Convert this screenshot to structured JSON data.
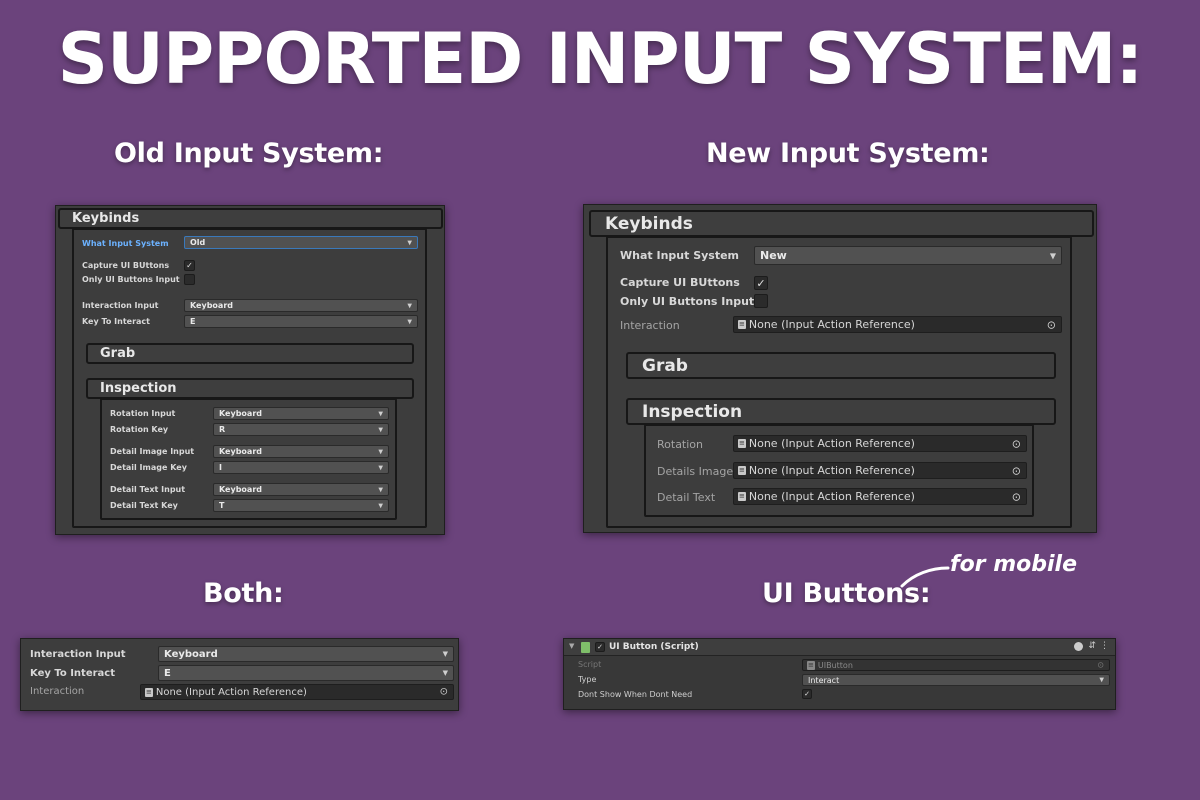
{
  "title": "SUPPORTED INPUT SYSTEM:",
  "old": {
    "heading": "Old Input System:",
    "keybinds": "Keybinds",
    "what_input_label": "What Input System",
    "what_input_value": "Old",
    "capture_label": "Capture UI BUttons",
    "capture_checked": true,
    "only_ui_label": "Only UI Buttons Input",
    "only_ui_checked": false,
    "interaction_input_label": "Interaction Input",
    "interaction_input_value": "Keyboard",
    "key_interact_label": "Key To Interact",
    "key_interact_value": "E",
    "grab": "Grab",
    "inspection": "Inspection",
    "rotation_input_label": "Rotation Input",
    "rotation_input_value": "Keyboard",
    "rotation_key_label": "Rotation Key",
    "rotation_key_value": "R",
    "detail_image_input_label": "Detail Image Input",
    "detail_image_input_value": "Keyboard",
    "detail_image_key_label": "Detail Image Key",
    "detail_image_key_value": "I",
    "detail_text_input_label": "Detail Text Input",
    "detail_text_input_value": "Keyboard",
    "detail_text_key_label": "Detail Text Key",
    "detail_text_key_value": "T"
  },
  "new": {
    "heading": "New Input System:",
    "keybinds": "Keybinds",
    "what_input_label": "What Input System",
    "what_input_value": "New",
    "capture_label": "Capture UI BUttons",
    "capture_checked": true,
    "only_ui_label": "Only UI Buttons Input",
    "only_ui_checked": false,
    "interaction_label": "Interaction",
    "interaction_value": "None (Input Action Reference)",
    "grab": "Grab",
    "inspection": "Inspection",
    "rotation_label": "Rotation",
    "rotation_value": "None (Input Action Reference)",
    "details_image_label": "Details Image",
    "details_image_value": "None (Input Action Reference)",
    "detail_text_label": "Detail Text",
    "detail_text_value": "None (Input Action Reference)"
  },
  "both": {
    "heading": "Both:",
    "interaction_input_label": "Interaction Input",
    "interaction_input_value": "Keyboard",
    "key_interact_label": "Key To Interact",
    "key_interact_value": "E",
    "interaction_label": "Interaction",
    "interaction_value": "None (Input Action Reference)"
  },
  "ui_buttons": {
    "heading": "UI Buttons:",
    "note": "for mobile",
    "component_title": "UI Button (Script)",
    "script_label": "Script",
    "script_value": "UIButton",
    "type_label": "Type",
    "type_value": "Interact",
    "dont_show_label": "Dont Show When Dont Need",
    "dont_show_checked": true
  },
  "icons": {
    "dropdown_arrow": "▼",
    "check": "✓",
    "target": "⊙",
    "doc": "≡"
  },
  "colors": {
    "background": "#6b437c",
    "panel": "#3d3d3d",
    "field": "#515151",
    "object_field": "#2a2a2a",
    "focus_label": "#6cb2ff"
  }
}
